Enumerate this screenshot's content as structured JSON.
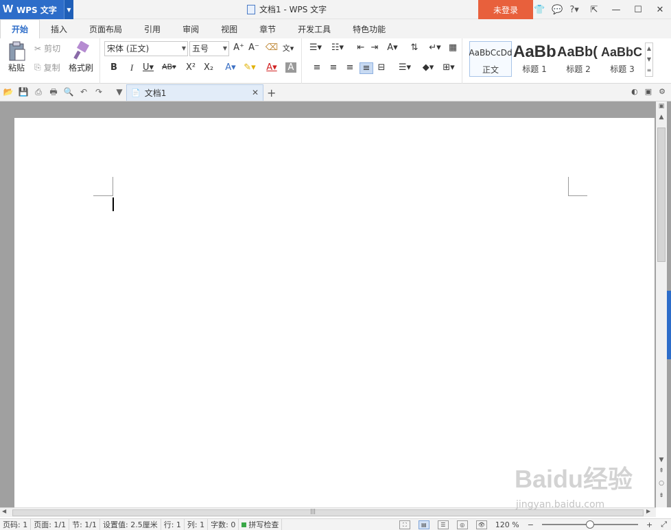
{
  "app": {
    "name": "WPS 文字",
    "logo": "W"
  },
  "window": {
    "title": "文档1 - WPS 文字",
    "login_label": "未登录"
  },
  "tabs": [
    "开始",
    "插入",
    "页面布局",
    "引用",
    "审阅",
    "视图",
    "章节",
    "开发工具",
    "特色功能"
  ],
  "ribbon": {
    "clipboard": {
      "paste": "粘贴",
      "cut": "剪切",
      "copy": "复制",
      "format_painter": "格式刷"
    },
    "font": {
      "name": "宋体 (正文)",
      "size": "五号"
    },
    "styles": [
      {
        "sample": "AaBbCcDd",
        "label": "正文"
      },
      {
        "sample": "AaBb",
        "label": "标题 1"
      },
      {
        "sample": "AaBb(",
        "label": "标题 2"
      },
      {
        "sample": "AaBbC",
        "label": "标题 3"
      }
    ]
  },
  "doc_tab": {
    "label": "文档1"
  },
  "status": {
    "page_num": "页码: 1",
    "pages": "页面: 1/1",
    "section": "节: 1/1",
    "setting": "设置值: 2.5厘米",
    "line": "行: 1",
    "col": "列: 1",
    "words": "字数: 0",
    "spell": "拼写检查",
    "zoom": "120 %"
  },
  "watermark": {
    "brand": "Baidu经验",
    "url": "jingyan.baidu.com"
  },
  "colors": {
    "accent": "#2d6dc9",
    "login": "#e8603c"
  }
}
